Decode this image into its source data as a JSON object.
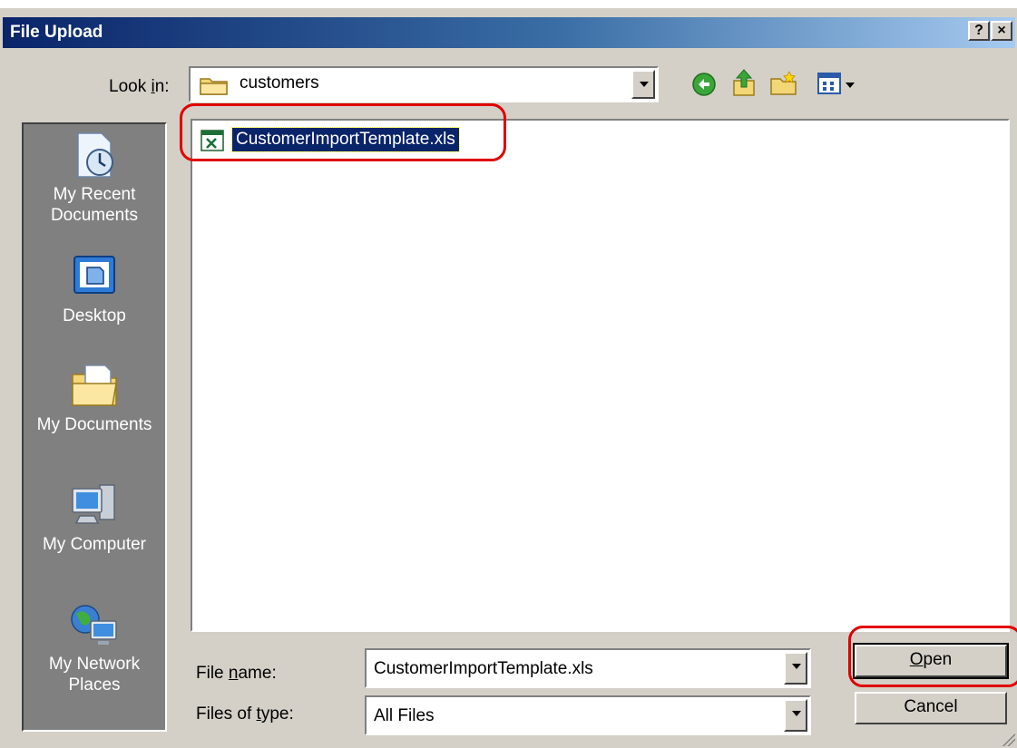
{
  "dialog": {
    "title": "File Upload",
    "help_button": "?",
    "close_button": "×"
  },
  "look_in": {
    "label_pre": "Look ",
    "label_u": "i",
    "label_post": "n:",
    "value": "customers",
    "toolbar_icons": [
      "back-icon",
      "up-folder-icon",
      "new-folder-icon",
      "view-menu-icon"
    ]
  },
  "places": [
    {
      "name": "recent",
      "label": "My Recent\nDocuments",
      "icon": "recent-documents-icon"
    },
    {
      "name": "desktop",
      "label": "Desktop",
      "icon": "desktop-icon"
    },
    {
      "name": "documents",
      "label": "My Documents",
      "icon": "my-documents-icon"
    },
    {
      "name": "computer",
      "label": "My Computer",
      "icon": "my-computer-icon"
    },
    {
      "name": "network",
      "label": "My Network\nPlaces",
      "icon": "my-network-places-icon"
    }
  ],
  "files": [
    {
      "name": "CustomerImportTemplate.xls",
      "icon": "excel-file-icon",
      "selected": true
    }
  ],
  "file_name": {
    "label_pre": "File ",
    "label_u": "n",
    "label_post": "ame:",
    "value": "CustomerImportTemplate.xls"
  },
  "file_type": {
    "label_pre": "Files of ",
    "label_u": "t",
    "label_post": "ype:",
    "value": "All Files"
  },
  "buttons": {
    "open_u": "O",
    "open_rest": "pen",
    "cancel": "Cancel"
  },
  "colors": {
    "title_gradient_start": "#0a246a",
    "title_gradient_end": "#a6caf0",
    "selection": "#0a246a",
    "highlight_ring": "#e00000",
    "dialog_face": "#d4d0c8"
  }
}
